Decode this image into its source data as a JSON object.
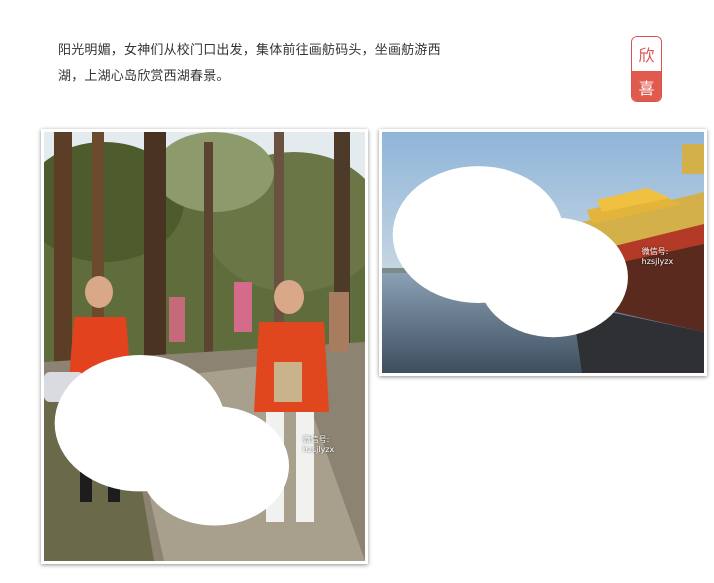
{
  "caption": {
    "line1": "阳光明媚，女神们从校门口出发，集体前往画舫码头，坐画舫游西",
    "line2": "湖，上湖心岛欣赏西湖春景。"
  },
  "badge": {
    "top_char": "欣",
    "bottom_char": "喜",
    "color": "#d9534f"
  },
  "photos": [
    {
      "description_icon": "group-walking-photo",
      "watermark_text": "微信号: hzsjlyzx"
    },
    {
      "description_icon": "painted-boat-photo",
      "watermark_text": "微信号: hzsjlyzx"
    }
  ]
}
